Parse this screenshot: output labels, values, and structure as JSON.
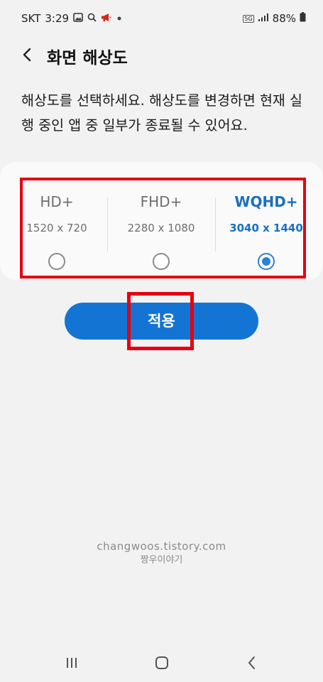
{
  "status": {
    "carrier": "SKT",
    "time": "3:29",
    "network": "5G",
    "battery": "88%",
    "icons": [
      "gallery-icon",
      "search-icon",
      "megaphone-icon",
      "dot-icon",
      "signal-icon",
      "battery-icon"
    ]
  },
  "header": {
    "title": "화면 해상도"
  },
  "description": "해상도를 선택하세요. 해상도를 변경하면 현재 실행 중인 앱 중 일부가 종료될 수 있어요.",
  "resolutions": [
    {
      "name": "HD+",
      "resolution": "1520 x 720",
      "selected": false
    },
    {
      "name": "FHD+",
      "resolution": "2280 x 1080",
      "selected": false
    },
    {
      "name": "WQHD+",
      "resolution": "3040 x 1440",
      "selected": true
    }
  ],
  "apply_label": "적용",
  "watermark": {
    "line1": "changwoos.tistory.com",
    "line2": "짱우이야기"
  },
  "colors": {
    "accent": "#1474d4",
    "highlight": "#e60012",
    "background": "#f2f2f2"
  }
}
